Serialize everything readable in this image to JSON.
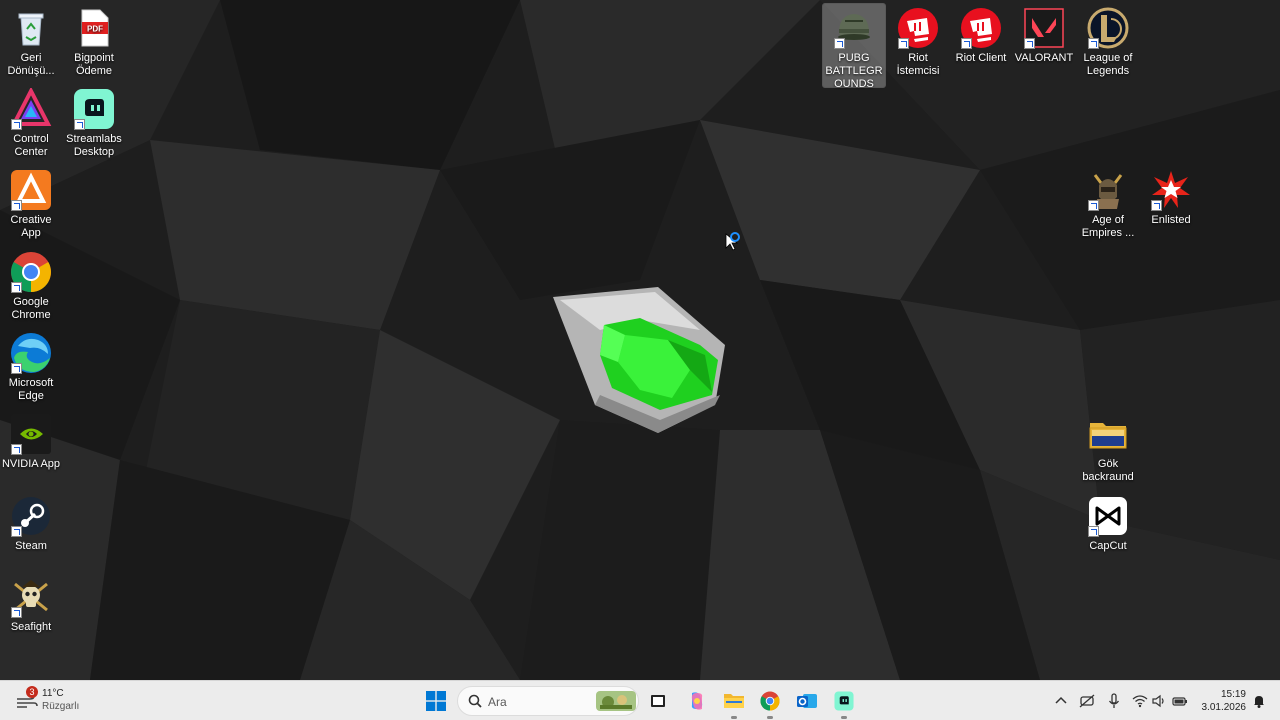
{
  "desktop": {
    "left_icons": [
      {
        "label": "Geri Dönüşü...",
        "icon": "recycle-bin-icon"
      },
      {
        "label": "Bigpoint Ödeme",
        "icon": "pdf-icon"
      },
      {
        "label": "Control Center",
        "icon": "control-center-icon"
      },
      {
        "label": "Streamlabs Desktop",
        "icon": "streamlabs-icon"
      },
      {
        "label": "Creative App",
        "icon": "creative-app-icon"
      },
      {
        "label": "Google Chrome",
        "icon": "chrome-icon"
      },
      {
        "label": "Microsoft Edge",
        "icon": "edge-icon"
      },
      {
        "label": "NVIDIA App",
        "icon": "nvidia-icon"
      },
      {
        "label": "Steam",
        "icon": "steam-icon"
      },
      {
        "label": "Seafight",
        "icon": "seafight-icon"
      }
    ],
    "right_icons": [
      {
        "label": "PUBG BATTLEGROUNDS",
        "icon": "pubg-icon",
        "selected": true
      },
      {
        "label": "Riot İstemcisi",
        "icon": "riot-icon"
      },
      {
        "label": "Riot Client",
        "icon": "riot-icon"
      },
      {
        "label": "VALORANT",
        "icon": "valorant-icon"
      },
      {
        "label": "League of Legends",
        "icon": "league-icon"
      },
      {
        "label": "Age of Empires ...",
        "icon": "age-of-empires-icon"
      },
      {
        "label": "Enlisted",
        "icon": "enlisted-icon"
      },
      {
        "label": "Gök backraund",
        "icon": "folder-icon"
      },
      {
        "label": "CapCut",
        "icon": "capcut-icon"
      }
    ]
  },
  "taskbar": {
    "weather": {
      "badge": "3",
      "temp": "11°C",
      "condition": "Rüzgarlı"
    },
    "search": {
      "placeholder": "Ara"
    },
    "pinned": [
      "windows-start-icon",
      "search-icon",
      "task-view-icon",
      "copilot-icon",
      "file-explorer-icon",
      "chrome-icon",
      "outlook-icon",
      "streamlabs-icon"
    ],
    "tray": [
      "chevron-up-icon",
      "no-location-icon",
      "microphone-icon",
      "wifi-icon",
      "volume-icon",
      "battery-icon"
    ],
    "clock": {
      "time": "15:19",
      "date": "3.01.2026"
    }
  },
  "colors": {
    "accent_green": "#2ee82e",
    "taskbar_bg": "#ececec",
    "riot_red": "#e8101f"
  }
}
